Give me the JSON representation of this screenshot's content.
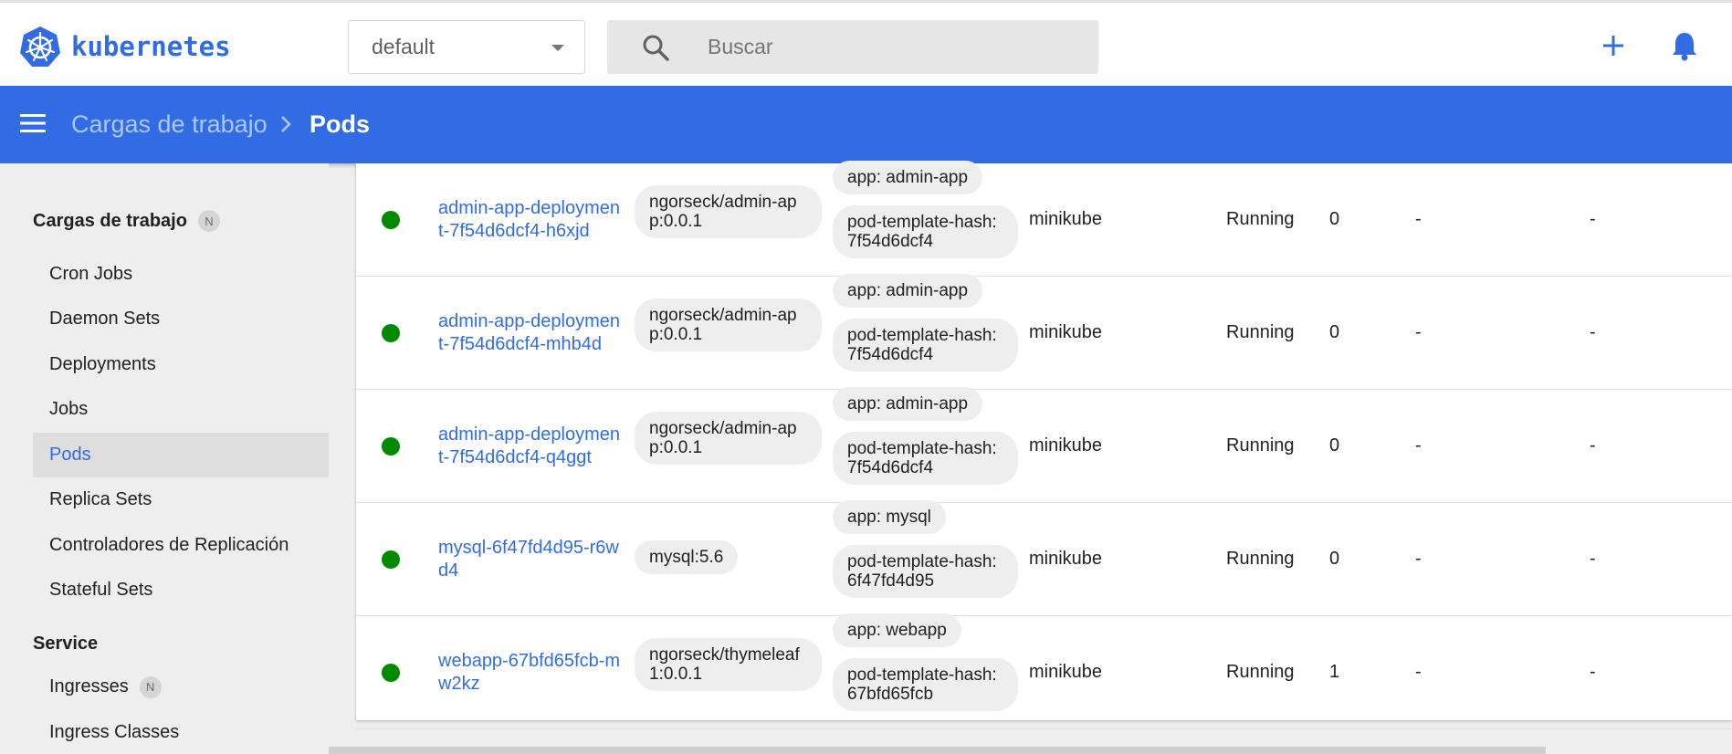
{
  "header": {
    "logo_text": "kubernetes",
    "namespace": "default",
    "search_placeholder": "Buscar",
    "accent_color": "#326ce5"
  },
  "toolbar": {
    "breadcrumb_parent": "Cargas de trabajo",
    "breadcrumb_current": "Pods"
  },
  "sidebar": {
    "workloads_title": "Cargas de trabajo",
    "workloads_badge": "N",
    "items": [
      {
        "label": "Cron Jobs"
      },
      {
        "label": "Daemon Sets"
      },
      {
        "label": "Deployments"
      },
      {
        "label": "Jobs"
      },
      {
        "label": "Pods"
      },
      {
        "label": "Replica Sets"
      },
      {
        "label": "Controladores de Replicación"
      },
      {
        "label": "Stateful Sets"
      }
    ],
    "service_title": "Service",
    "service_items": [
      {
        "label": "Ingresses",
        "badge": "N"
      },
      {
        "label": "Ingress Classes"
      }
    ]
  },
  "pods": [
    {
      "status": "running",
      "name": "admin-app-deployment-7f54d6dcf4-h6xjd",
      "image": "ngorseck/admin-app:0.0.1",
      "label_app": "app: admin-app",
      "label_hash": "pod-template-hash: 7f54d6dcf4",
      "node": "minikube",
      "state": "Running",
      "restarts": "0",
      "cpu": "-",
      "memory": "-"
    },
    {
      "status": "running",
      "name": "admin-app-deployment-7f54d6dcf4-mhb4d",
      "image": "ngorseck/admin-app:0.0.1",
      "label_app": "app: admin-app",
      "label_hash": "pod-template-hash: 7f54d6dcf4",
      "node": "minikube",
      "state": "Running",
      "restarts": "0",
      "cpu": "-",
      "memory": "-"
    },
    {
      "status": "running",
      "name": "admin-app-deployment-7f54d6dcf4-q4ggt",
      "image": "ngorseck/admin-app:0.0.1",
      "label_app": "app: admin-app",
      "label_hash": "pod-template-hash: 7f54d6dcf4",
      "node": "minikube",
      "state": "Running",
      "restarts": "0",
      "cpu": "-",
      "memory": "-"
    },
    {
      "status": "running",
      "name": "mysql-6f47fd4d95-r6wd4",
      "image": "mysql:5.6",
      "label_app": "app: mysql",
      "label_hash": "pod-template-hash: 6f47fd4d95",
      "node": "minikube",
      "state": "Running",
      "restarts": "0",
      "cpu": "-",
      "memory": "-"
    },
    {
      "status": "running",
      "name": "webapp-67bfd65fcb-mw2kz",
      "image": "ngorseck/thymeleaf1:0.0.1",
      "label_app": "app: webapp",
      "label_hash": "pod-template-hash: 67bfd65fcb",
      "node": "minikube",
      "state": "Running",
      "restarts": "1",
      "cpu": "-",
      "memory": "-"
    }
  ]
}
